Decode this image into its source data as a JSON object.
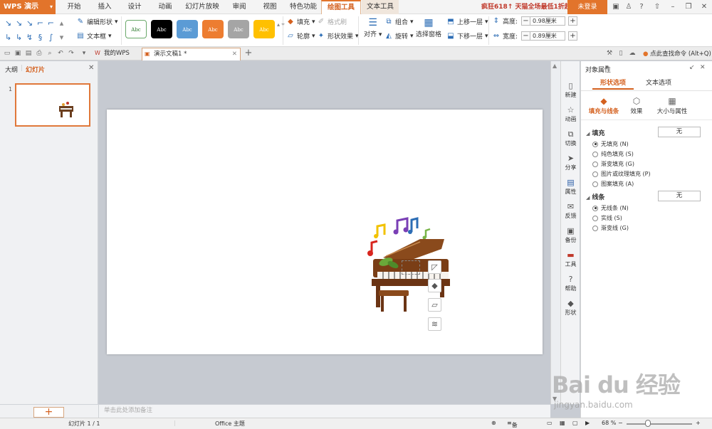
{
  "app": {
    "name": "WPS 演示"
  },
  "ribbon_tabs": [
    "开始",
    "插入",
    "设计",
    "动画",
    "幻灯片放映",
    "审阅",
    "视图",
    "特色功能",
    "绘图工具",
    "文本工具"
  ],
  "active_tab": "绘图工具",
  "promo_text": "疯狂618↑ 天猫全场最低1折起",
  "login_label": "未登录",
  "ribbon": {
    "edit_shape": "编辑形状",
    "text_box": "文本框",
    "style_swatches": [
      {
        "label": "Abc",
        "bg": "#ffffff",
        "fg": "#2c7a2c",
        "border": "#6aa86a"
      },
      {
        "label": "Abc",
        "bg": "#000000",
        "fg": "#ffffff",
        "border": "#000000"
      },
      {
        "label": "Abc",
        "bg": "#5b9bd5",
        "fg": "#ffffff",
        "border": "#5b9bd5"
      },
      {
        "label": "Abc",
        "bg": "#ed7d31",
        "fg": "#ffffff",
        "border": "#ed7d31"
      },
      {
        "label": "Abc",
        "bg": "#a5a5a5",
        "fg": "#ffffff",
        "border": "#a5a5a5"
      },
      {
        "label": "Abc",
        "bg": "#ffc000",
        "fg": "#ffffff",
        "border": "#ffc000"
      }
    ],
    "fill": "填充",
    "format_painter": "格式刷",
    "outline": "轮廓",
    "shape_effects": "形状效果",
    "align": "对齐",
    "group": "组合",
    "rotate": "旋转",
    "selection_pane": "选择窗格",
    "bring_forward": "上移一层",
    "send_backward": "下移一层",
    "height_label": "高度:",
    "height_value": "0.98厘米",
    "width_label": "宽度:",
    "width_value": "0.89厘米"
  },
  "docbar": {
    "tabs": [
      {
        "label": "我的WPS",
        "active": false
      },
      {
        "label": "演示文稿1 *",
        "active": true
      }
    ],
    "find_command": "点此查找命令 (Alt+Q)"
  },
  "left_panel": {
    "tab_outline": "大纲",
    "tab_slides": "幻灯片",
    "slide_number": "1"
  },
  "notes_placeholder": "单击此处添加备注",
  "vertical_tools": [
    "新建",
    "动画",
    "切换",
    "分享",
    "属性",
    "反馈",
    "备份",
    "工具",
    "帮助",
    "形状"
  ],
  "props": {
    "title": "对象属性",
    "tabs": [
      "形状选项",
      "文本选项"
    ],
    "subtabs": [
      "填充与线条",
      "效果",
      "大小与属性"
    ],
    "fill_section": "填充",
    "fill_value": "无",
    "fill_options": [
      {
        "label": "无填充 (N)",
        "checked": true
      },
      {
        "label": "纯色填充 (S)",
        "checked": false
      },
      {
        "label": "渐变填充 (G)",
        "checked": false
      },
      {
        "label": "图片或纹理填充 (P)",
        "checked": false
      },
      {
        "label": "图案填充 (A)",
        "checked": false
      }
    ],
    "line_section": "线条",
    "line_value": "无",
    "line_options": [
      {
        "label": "无线条 (N)",
        "checked": true
      },
      {
        "label": "实线 (S)",
        "checked": false
      },
      {
        "label": "渐变线 (G)",
        "checked": false
      }
    ]
  },
  "status": {
    "slide_indicator": "幻灯片 1 / 1",
    "theme": "Office 主题",
    "notes": "备注",
    "zoom": "68 %"
  },
  "watermark": {
    "line1": "Bai du 经验",
    "line2": "jingyan.baidu.com"
  }
}
